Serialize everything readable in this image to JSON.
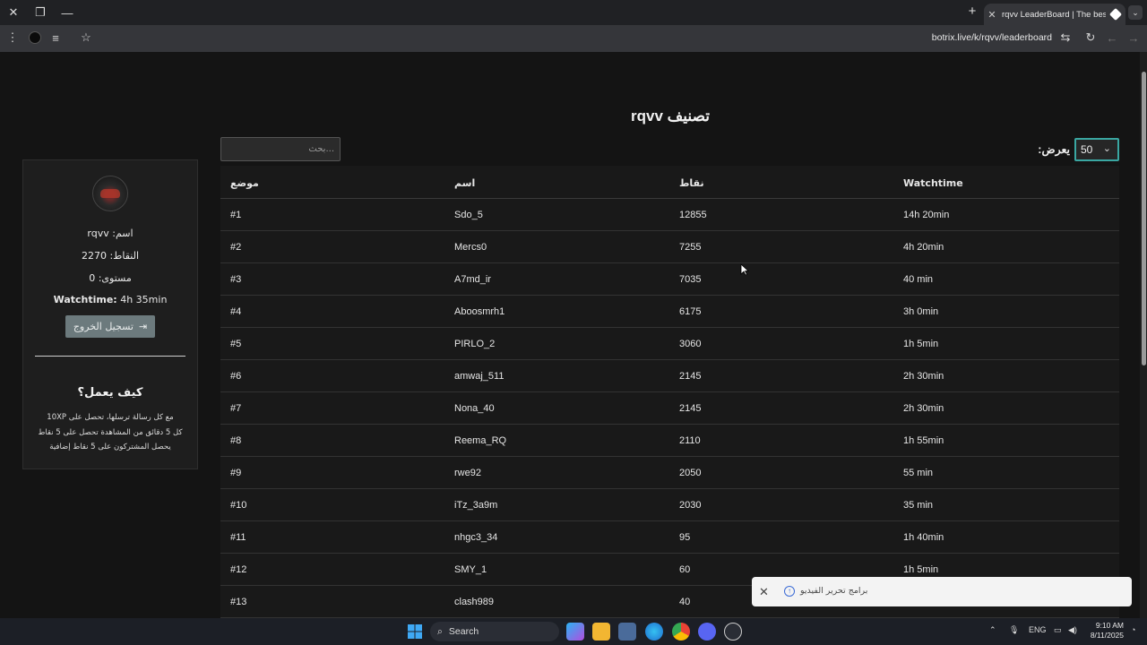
{
  "browser": {
    "tab_title": "rqvv LeaderBoard | The best Ch",
    "url": "botrix.live/k/rqvv/leaderboard"
  },
  "page": {
    "title": "rqvv تصنيف",
    "search_placeholder": "...بحث",
    "show_label": ":يعرض",
    "show_value": "50"
  },
  "profile": {
    "name_line": "rqvv :اسم",
    "points_line": "النقاط: 2270",
    "level_line": "مستوى: 0",
    "watchtime_label": "Watchtime:",
    "watchtime_value": "4h 35min",
    "logout_label": "تسجيل الخروج",
    "how_title": "كيف يعمل؟",
    "how_lines": [
      "مع كل رسالة ترسلها، تحصل على 10XP",
      "كل 5 دقائق من المشاهدة تحصل على 5 نقاط",
      "يحصل المشتركون على 5 نقاط إضافية"
    ]
  },
  "table": {
    "headers": [
      "موضع",
      "اسم",
      "نقاط",
      "Watchtime"
    ],
    "rows": [
      [
        "#1",
        "Sdo_5",
        "12855",
        "14h 20min"
      ],
      [
        "#2",
        "Mercs0",
        "7255",
        "4h 20min"
      ],
      [
        "#3",
        "A7md_ir",
        "7035",
        "40 min"
      ],
      [
        "#4",
        "Aboosmrh1",
        "6175",
        "3h 0min"
      ],
      [
        "#5",
        "PIRLO_2",
        "3060",
        "1h 5min"
      ],
      [
        "#6",
        "amwaj_511",
        "2145",
        "2h 30min"
      ],
      [
        "#7",
        "Nona_40",
        "2145",
        "2h 30min"
      ],
      [
        "#8",
        "Reema_RQ",
        "2110",
        "1h 55min"
      ],
      [
        "#9",
        "rwe92",
        "2050",
        "55 min"
      ],
      [
        "#10",
        "iTz_3a9m",
        "2030",
        "35 min"
      ],
      [
        "#11",
        "nhgc3_34",
        "95",
        "1h 40min"
      ],
      [
        "#12",
        "SMY_1",
        "60",
        "1h 5min"
      ],
      [
        "#13",
        "clash989",
        "40",
        ""
      ]
    ]
  },
  "toast": {
    "text": "برامج تحرير الفيديو"
  },
  "taskbar": {
    "search_label": "Search",
    "lang": "ENG",
    "time": "9:10 AM",
    "date": "8/11/2025"
  }
}
